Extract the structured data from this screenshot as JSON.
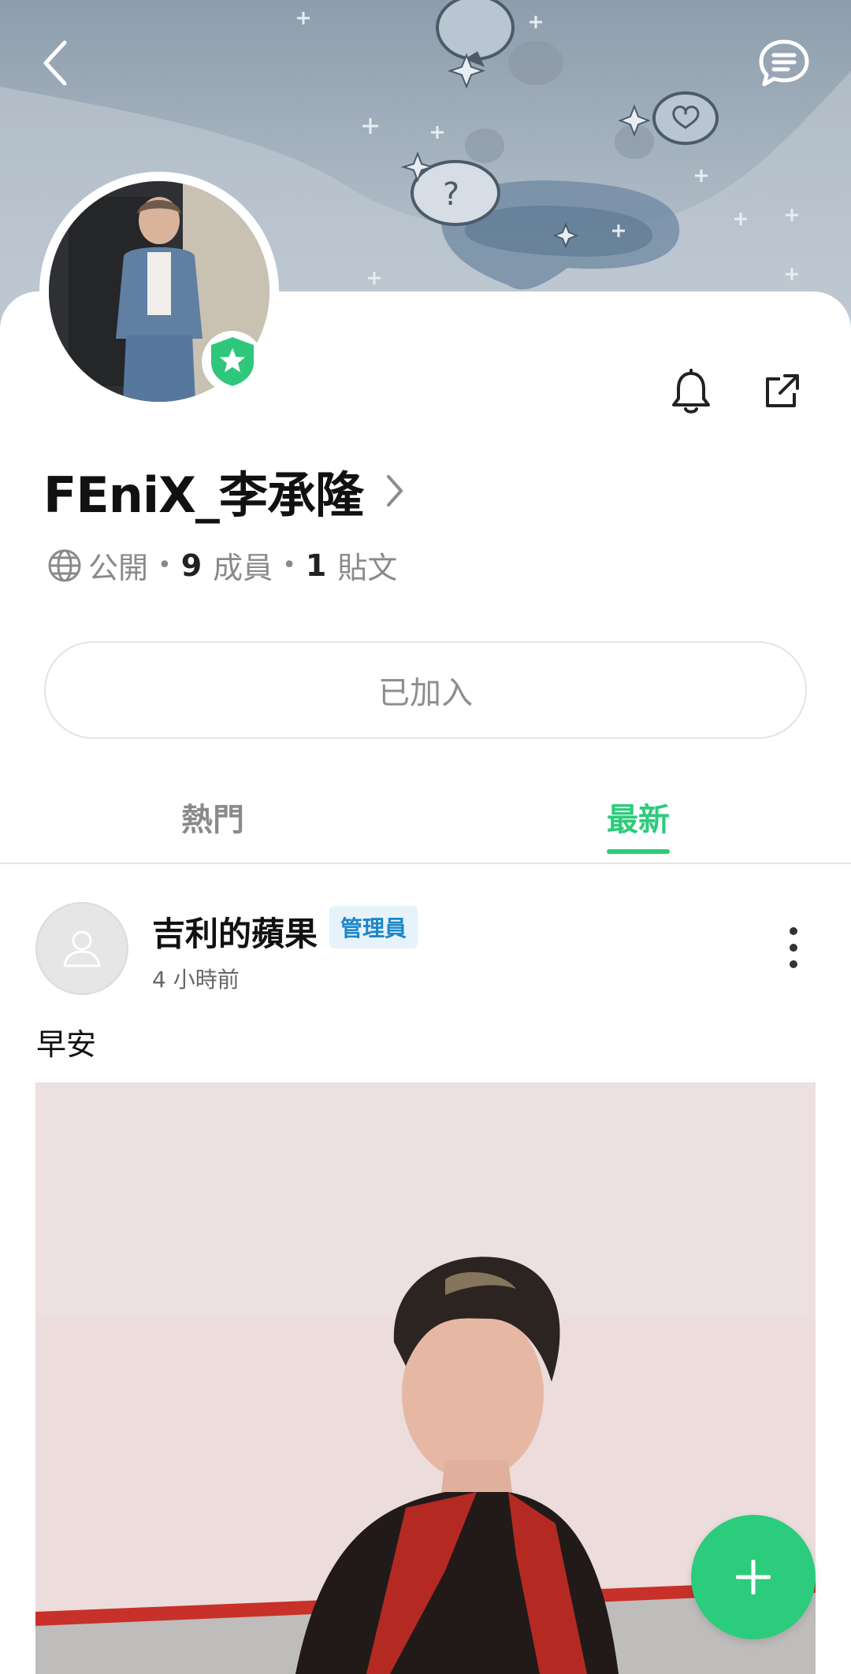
{
  "header": {
    "back_icon": "chevron-left-icon",
    "chat_icon": "chat-bubble-icon"
  },
  "group": {
    "title": "FEniX_李承隆",
    "visibility": "公開",
    "members_count": "9",
    "members_label": "成員",
    "posts_count": "1",
    "posts_label": "貼文",
    "join_label": "已加入"
  },
  "actions": {
    "bell_icon": "bell-icon",
    "share_icon": "external-share-icon"
  },
  "tabs": [
    {
      "label": "熱門",
      "active": false
    },
    {
      "label": "最新",
      "active": true
    }
  ],
  "post": {
    "author": "吉利的蘋果",
    "role_badge": "管理員",
    "time": "4 小時前",
    "text": "早安"
  },
  "colors": {
    "accent": "#2ccc7a",
    "admin_badge_bg": "#e6f3fb",
    "admin_badge_text": "#1e86c8"
  },
  "fab": {
    "icon": "plus-icon"
  }
}
